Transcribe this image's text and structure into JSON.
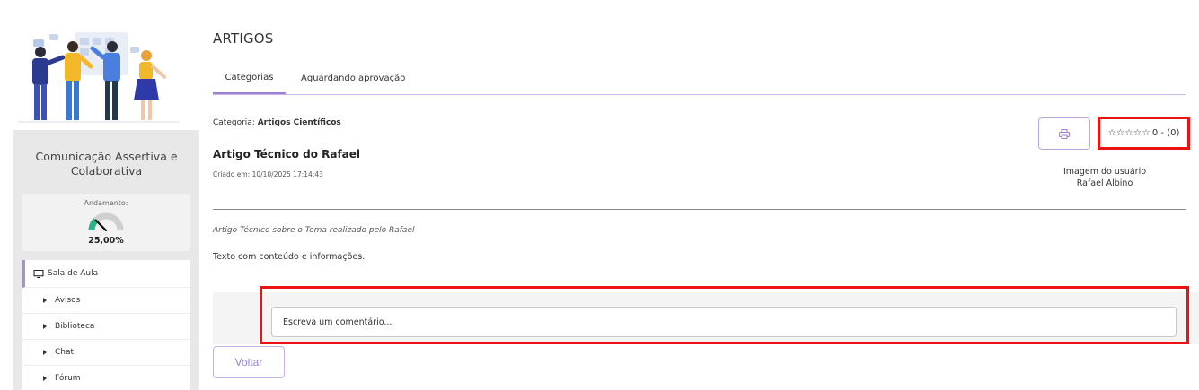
{
  "sidebar": {
    "course_title": "Comunicação Assertiva e Colaborativa",
    "progress": {
      "label": "Andamento:",
      "value_text": "25,00%",
      "value": 25
    },
    "menu": {
      "main_label": "Sala de Aula",
      "main_icon": "monitor-icon",
      "items": [
        {
          "label": "Avisos"
        },
        {
          "label": "Biblioteca"
        },
        {
          "label": "Chat"
        },
        {
          "label": "Fórum"
        }
      ]
    }
  },
  "page": {
    "title": "ARTIGOS",
    "tabs": [
      {
        "label": "Categorias",
        "active": true
      },
      {
        "label": "Aguardando aprovação",
        "active": false
      }
    ]
  },
  "article": {
    "category_prefix": "Categoria:",
    "category_name": "Artigos Científicos",
    "title": "Artigo Técnico do Rafael",
    "created": "Criado em: 10/10/2025 17:14:43",
    "summary": "Artigo Técnico sobre o Tema realizado pelo Rafael",
    "content": "Texto com conteúdo e informações.",
    "rating": {
      "stars_filled": 0,
      "stars_total": 5,
      "text": "0 - (0)"
    },
    "user_image_alt": "Imagem do usuário",
    "author": "Rafael Albino"
  },
  "comments": {
    "placeholder": "Escreva um comentário..."
  },
  "actions": {
    "back_label": "Voltar"
  },
  "colors": {
    "accent": "#9c7fd3",
    "highlight": "#ee1111",
    "sidebar_bg": "#e8e8e8"
  }
}
